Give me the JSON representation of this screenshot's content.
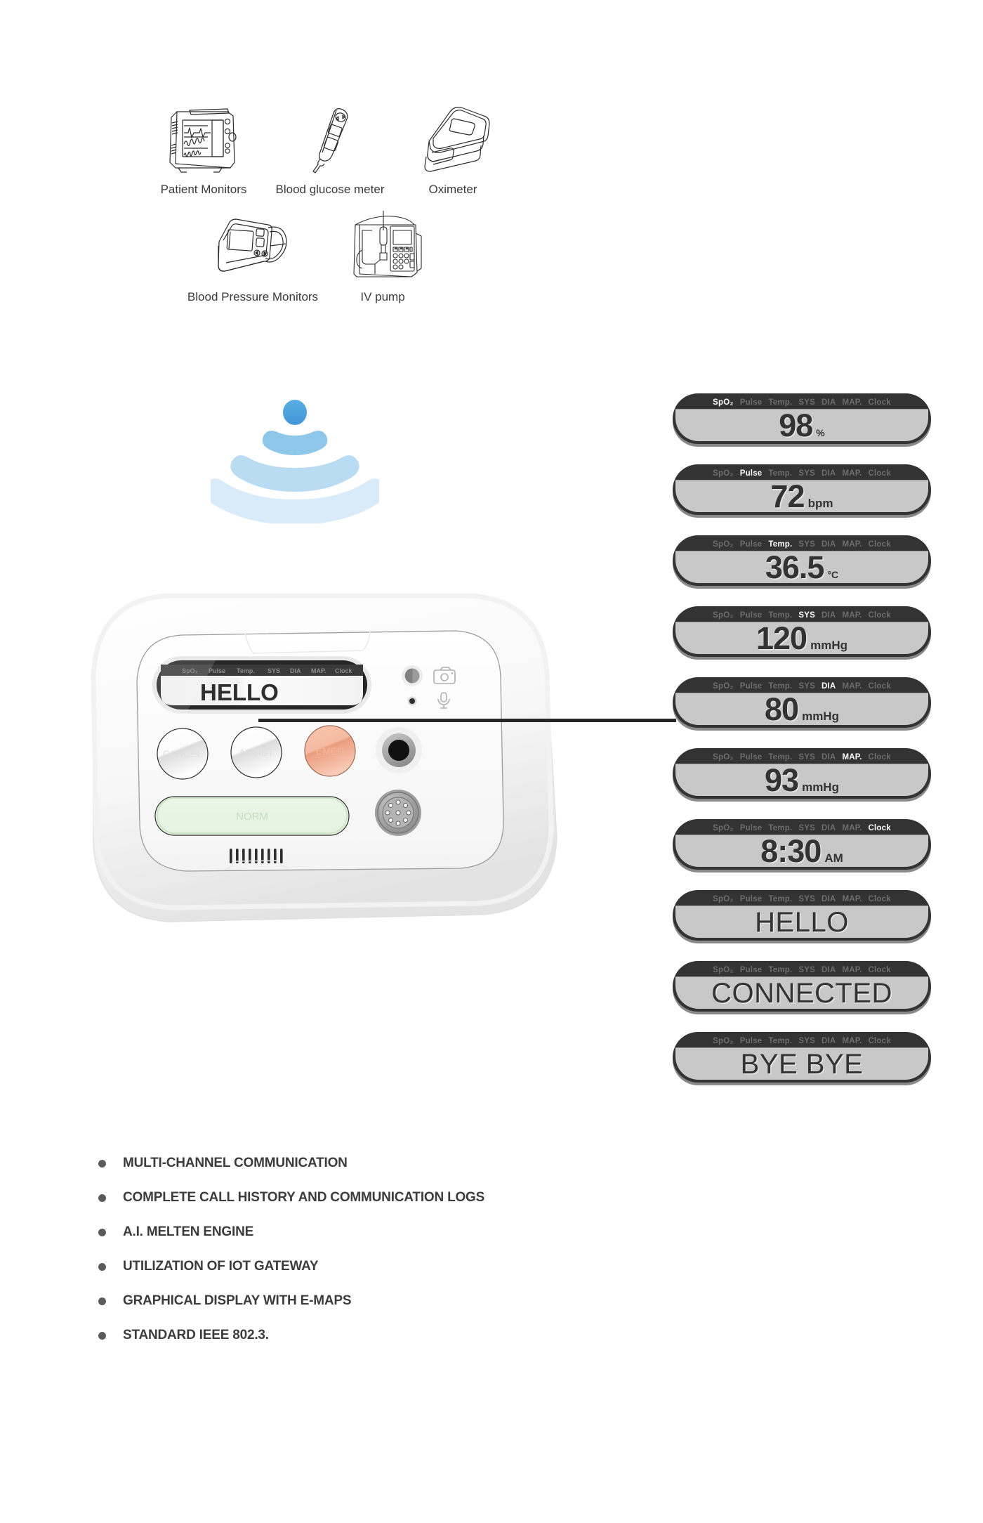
{
  "devices": {
    "row1": [
      {
        "label": "Patient Monitors",
        "icon": "patient-monitor-icon"
      },
      {
        "label": "Blood glucose meter",
        "icon": "glucose-meter-icon"
      },
      {
        "label": "Oximeter",
        "icon": "oximeter-icon"
      }
    ],
    "row2": [
      {
        "label": "Blood Pressure Monitors",
        "icon": "blood-pressure-monitor-icon"
      },
      {
        "label": "IV pump",
        "icon": "iv-pump-icon"
      }
    ]
  },
  "signal": {
    "icon": "wireless-signal-icon",
    "colors": [
      "#4ea3dd",
      "#8ec7ea",
      "#b9dcf3",
      "#d9ebf8"
    ]
  },
  "unit": {
    "display_text": "HELLO",
    "tabs": [
      "SpO₂",
      "Pulse",
      "Temp.",
      "SYS",
      "DIA",
      "MAP.",
      "Clock"
    ],
    "buttons": [
      {
        "label": "CANCEL",
        "name": "cancel-button",
        "color": "#ffffff"
      },
      {
        "label": "ASSIST",
        "name": "assist-button",
        "color": "#ffffff"
      },
      {
        "label": "EMER",
        "name": "emergency-button",
        "color": "#f4a58a"
      }
    ],
    "norm_label": "NORM",
    "norm_color": "#e9f4e6",
    "icons": [
      "camera-icon",
      "microphone-icon",
      "speaker-grille-icon",
      "connector-port-icon",
      "dial-knob-icon"
    ]
  },
  "panels": [
    {
      "active": "SpO₂",
      "value": "98",
      "unit": "%",
      "unit_small": true,
      "word": false,
      "name": "readout-spo2"
    },
    {
      "active": "Pulse",
      "value": "72",
      "unit": "bpm",
      "unit_small": false,
      "word": false,
      "name": "readout-pulse"
    },
    {
      "active": "Temp.",
      "value": "36.5",
      "unit": "°C",
      "unit_small": true,
      "word": false,
      "name": "readout-temperature"
    },
    {
      "active": "SYS",
      "value": "120",
      "unit": "mmHg",
      "unit_small": false,
      "word": false,
      "name": "readout-sys"
    },
    {
      "active": "DIA",
      "value": "80",
      "unit": "mmHg",
      "unit_small": false,
      "word": false,
      "name": "readout-dia"
    },
    {
      "active": "MAP.",
      "value": "93",
      "unit": "mmHg",
      "unit_small": false,
      "word": false,
      "name": "readout-map"
    },
    {
      "active": "Clock",
      "value": "8:30",
      "unit": "AM",
      "unit_small": false,
      "word": false,
      "name": "readout-clock"
    },
    {
      "active": "",
      "value": "HELLO",
      "unit": "",
      "unit_small": false,
      "word": true,
      "name": "readout-hello"
    },
    {
      "active": "",
      "value": "CONNECTED",
      "unit": "",
      "unit_small": false,
      "word": true,
      "name": "readout-connected"
    },
    {
      "active": "",
      "value": "BYE BYE",
      "unit": "",
      "unit_small": false,
      "word": true,
      "name": "readout-bye-bye"
    }
  ],
  "tabs_all": [
    "SpO₂",
    "Pulse",
    "Temp.",
    "SYS",
    "DIA",
    "MAP.",
    "Clock"
  ],
  "features": [
    "MULTI-CHANNEL COMMUNICATION",
    "COMPLETE CALL HISTORY AND COMMUNICATION LOGS",
    "A.I. MELTEN ENGINE",
    "UTILIZATION OF IOT GATEWAY",
    "GRAPHICAL DISPLAY WITH E-MAPS",
    "STANDARD IEEE 802.3."
  ]
}
